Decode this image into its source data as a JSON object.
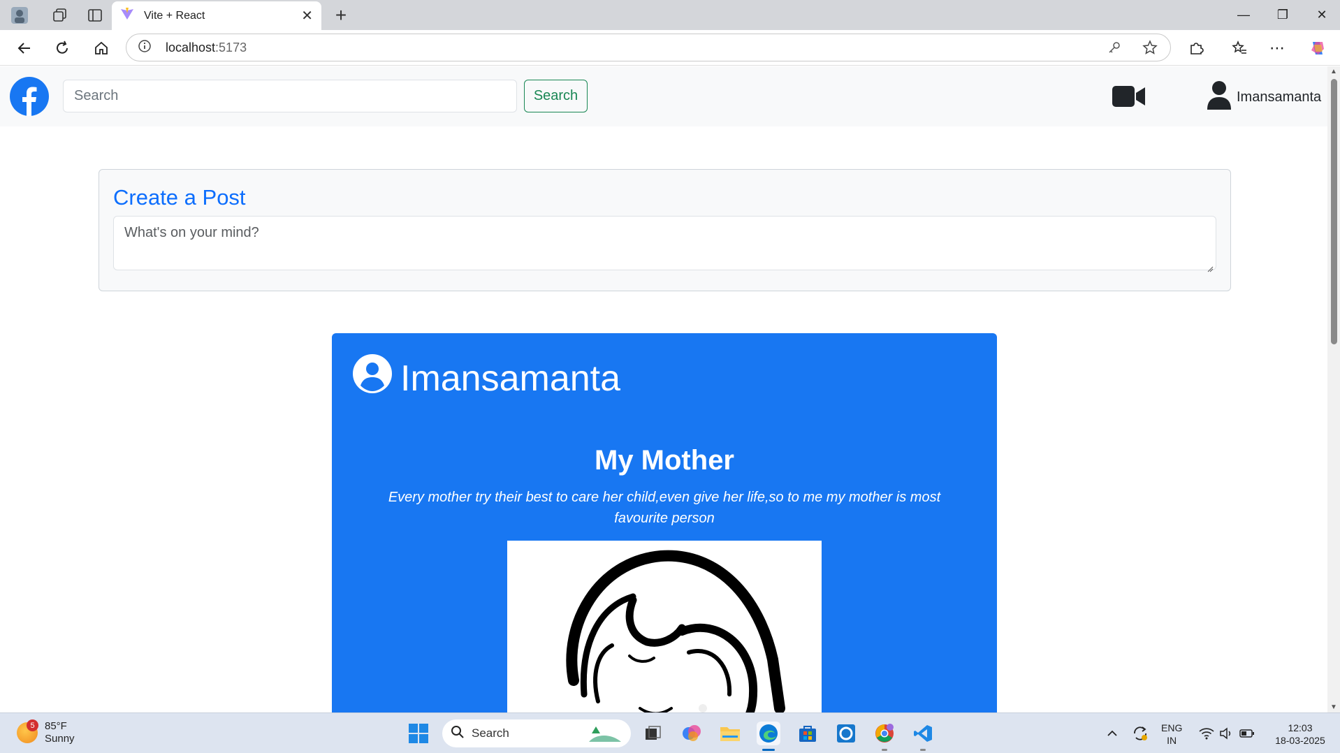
{
  "browser": {
    "tab_title": "Vite + React",
    "address_host": "localhost",
    "address_port": ":5173"
  },
  "header": {
    "search_placeholder": "Search",
    "search_button": "Search",
    "username": "Imansamanta"
  },
  "create_post": {
    "title": "Create a Post",
    "placeholder": "What's on your mind?"
  },
  "post": {
    "author": "Imansamanta",
    "title": "My Mother",
    "body": "Every mother try their best to care her child,even give her life,so to me my mother is most favourite person"
  },
  "taskbar": {
    "weather_temp": "85°F",
    "weather_desc": "Sunny",
    "weather_badge": "5",
    "search_label": "Search",
    "lang_1": "ENG",
    "lang_2": "IN",
    "time": "12:03",
    "date": "18-03-2025"
  },
  "colors": {
    "facebook_blue": "#1877f2",
    "bootstrap_primary": "#0d6efd",
    "success_green": "#198754"
  }
}
